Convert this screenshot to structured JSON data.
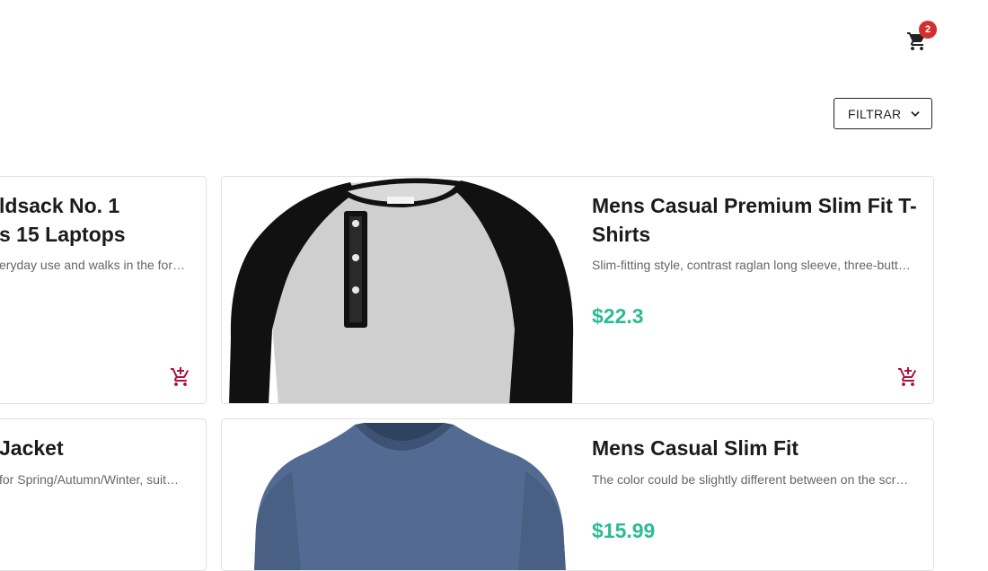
{
  "header": {
    "cart_count": "2"
  },
  "toolbar": {
    "filter_label": "FILTRAR"
  },
  "products": [
    {
      "title_line1": "ldsack No. 1",
      "title_line2": "s 15 Laptops",
      "description": "eryday use and walks in the for…"
    },
    {
      "title": "Mens Casual Premium Slim Fit T-Shirts",
      "description": "Slim-fitting style, contrast raglan long sleeve, three-butt…",
      "price": "$22.3"
    },
    {
      "title": "Jacket",
      "description": " for Spring/Autumn/Winter, suit…"
    },
    {
      "title": "Mens Casual Slim Fit",
      "description": "The color could be slightly different between on the scr…",
      "price": "$15.99"
    }
  ],
  "colors": {
    "accent_green": "#2bbb95",
    "cart_icon_red": "#b0123a",
    "badge_red": "#d32f2f"
  },
  "icons": {
    "cart": "shopping-cart-icon",
    "add_to_cart": "add-shopping-cart-icon",
    "filter_chevron": "chevron-down-icon"
  }
}
